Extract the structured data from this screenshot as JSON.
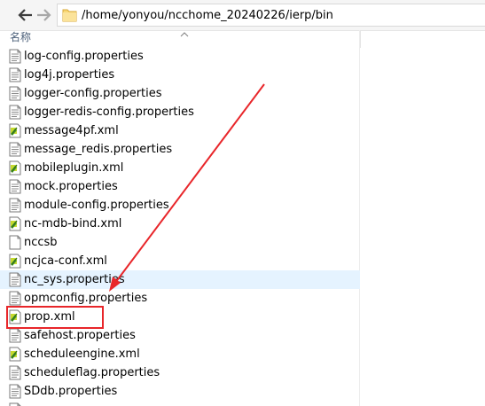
{
  "address_bar": {
    "path": "/home/yonyou/ncchome_20240226/ierp/bin"
  },
  "column_header": {
    "name_label": "名称"
  },
  "files": [
    {
      "name": "log-config.properties",
      "icon": "text-file-icon",
      "selected": false
    },
    {
      "name": "log4j.properties",
      "icon": "text-file-icon",
      "selected": false
    },
    {
      "name": "logger-config.properties",
      "icon": "text-file-icon",
      "selected": false
    },
    {
      "name": "logger-redis-config.properties",
      "icon": "text-file-icon",
      "selected": false
    },
    {
      "name": "message4pf.xml",
      "icon": "xml-file-icon",
      "selected": false
    },
    {
      "name": "message_redis.properties",
      "icon": "text-file-icon",
      "selected": false
    },
    {
      "name": "mobileplugin.xml",
      "icon": "xml-file-icon",
      "selected": false
    },
    {
      "name": "mock.properties",
      "icon": "text-file-icon",
      "selected": false
    },
    {
      "name": "module-config.properties",
      "icon": "text-file-icon",
      "selected": false
    },
    {
      "name": "nc-mdb-bind.xml",
      "icon": "xml-file-icon",
      "selected": false
    },
    {
      "name": "nccsb",
      "icon": "blank-file-icon",
      "selected": false
    },
    {
      "name": "ncjca-conf.xml",
      "icon": "xml-file-icon",
      "selected": false
    },
    {
      "name": "nc_sys.properties",
      "icon": "text-file-icon",
      "selected": true
    },
    {
      "name": "opmconfig.properties",
      "icon": "text-file-icon",
      "selected": false
    },
    {
      "name": "prop.xml",
      "icon": "xml-file-icon",
      "selected": false
    },
    {
      "name": "safehost.properties",
      "icon": "text-file-icon",
      "selected": false
    },
    {
      "name": "scheduleengine.xml",
      "icon": "xml-file-icon",
      "selected": false
    },
    {
      "name": "scheduleflag.properties",
      "icon": "text-file-icon",
      "selected": false
    },
    {
      "name": "SDdb.properties",
      "icon": "text-file-icon",
      "selected": false
    },
    {
      "name": "",
      "icon": "text-file-icon",
      "selected": false
    }
  ],
  "annotation": {
    "highlight_color": "#e8262a",
    "highlighted_file": "prop.xml"
  },
  "colors": {
    "selection": "#e5f3ff",
    "header_text": "#4c607a"
  }
}
